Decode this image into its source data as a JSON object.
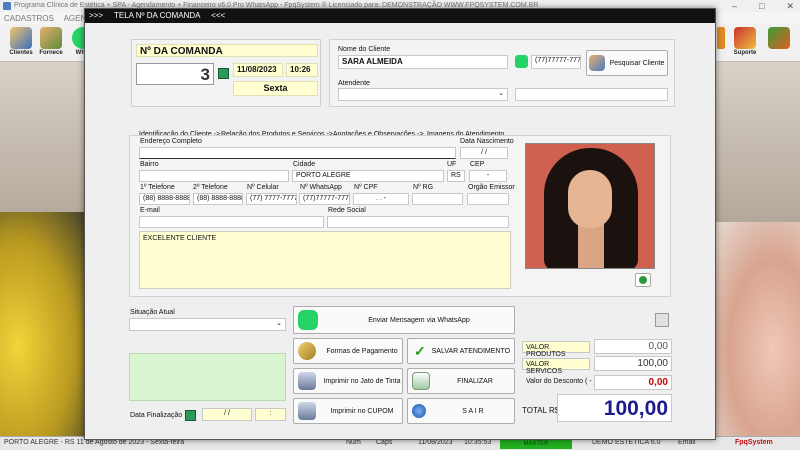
{
  "background": {
    "window_title": "Programa Clínica de Estética + SPA - Agendamento + Financeiro v6.0 Pro WhatsApp - FpqSystem ® Licenciado para: DEMONSTRAÇÃO WWW.FPQSYSTEM.COM.BR",
    "menu": [
      "CADASTROS",
      "AGENDA"
    ],
    "toolbar": [
      {
        "label": "Clientes"
      },
      {
        "label": "Fornece"
      },
      {
        "label": "What"
      },
      {
        "label": "Suporte"
      },
      {
        "label": ""
      }
    ],
    "status": {
      "city_date": "PORTO ALEGRE - RS 11 de Agosto de 2023 - Sexta-feira",
      "num": "Num",
      "caps": "Caps",
      "date": "11/08/2023",
      "time": "10:35:53",
      "user": "MASTER",
      "version": "DEMO ESTÉTICA 6.0",
      "email": "Email",
      "brand": "FpqSystem"
    }
  },
  "dialog": {
    "title": ">>>     TELA Nº DA COMANDA     <<<",
    "comanda": {
      "label": "Nº DA COMANDA",
      "number": "3",
      "date": "11/08/2023",
      "time": "10:26",
      "weekday": "Sexta"
    },
    "cliente": {
      "name_label": "Nome do Cliente",
      "name": "SARA ALMEIDA",
      "phone": "(77)77777-7777",
      "search_button": "Pesquisar Cliente",
      "atendente_label": "Atendente",
      "atendente_value": ""
    },
    "tabs": [
      "Identificação do Cliente ->",
      "Relação dos Produtos e Serviços ->",
      "Anotações e Observações ->",
      "Imagens do Atendimento"
    ],
    "form": {
      "endereco_label": "Endereço Completo",
      "endereco": "",
      "nascimento_label": "Data Nascimento",
      "nascimento": " /  /",
      "bairro_label": "Bairro",
      "bairro": "",
      "cidade_label": "Cidade",
      "cidade": "PORTO ALEGRE",
      "uf_label": "UF",
      "uf": "RS",
      "cep_label": "CEP",
      "cep": "-",
      "tel1_label": "1º Telefone",
      "tel1": "(88) 8888-8888",
      "tel2_label": "2º Telefone",
      "tel2": "(88) 8888-8888",
      "celular_label": "Nº Celular",
      "celular": "(77) 7777-7777",
      "whatsapp_label": "Nº WhatsApp",
      "whatsapp": "(77)77777-7777",
      "cpf_label": "Nº CPF",
      "cpf": ". . -",
      "rg_label": "Nº RG",
      "rg": "",
      "orgao_label": "Orgão Emissor",
      "orgao": "",
      "email_label": "E-mail",
      "email": "",
      "rede_label": "Rede Social",
      "rede": "",
      "observacao": "EXCELENTE CLIENTE"
    },
    "situacao_label": "Situação Atual",
    "situacao_value": "",
    "data_finalizacao_label": "Data Finalização",
    "data_finalizacao": " /  /",
    "hora_finalizacao": ":",
    "buttons": {
      "whatsapp": "Enviar Mensagem via WhatsApp",
      "pagamento": "Formas de Pagamento",
      "salvar": "SALVAR  ATENDIMENTO",
      "imprimir_jato": "Imprimir no Jato de Tinta",
      "finalizar": "FINALIZAR",
      "imprimir_cupom": "Imprimir no CUPOM",
      "sair": "S A I R"
    },
    "totais": {
      "produtos_label": "VALOR PRODUTOS",
      "produtos": "0,00",
      "servicos_label": "VALOR SERVICOS",
      "servicos": "100,00",
      "desconto_label": "Valor do Desconto ( - )",
      "desconto": "0,00",
      "total_label": "TOTAL R$",
      "total": "100,00"
    }
  },
  "colors": {
    "field_yellow": "#ffffd2",
    "total_blue": "#1c1c8c",
    "discount_red": "#cc0000",
    "whatsapp_green": "#25d366",
    "title_bar": "#111111"
  }
}
